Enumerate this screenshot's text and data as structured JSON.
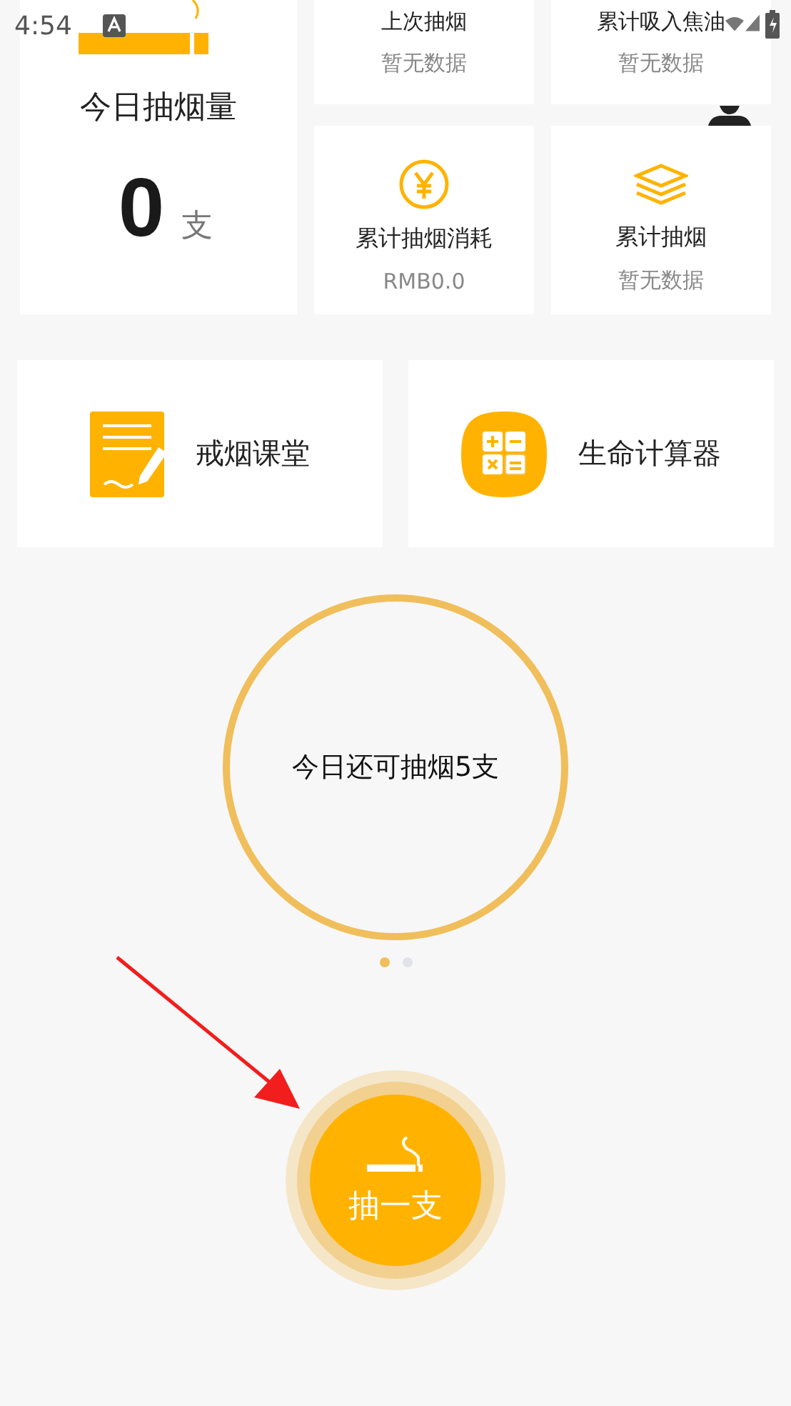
{
  "status_bar": {
    "time": "4:54"
  },
  "today_card": {
    "title": "今日抽烟量",
    "count": "0",
    "unit": "支"
  },
  "stats": [
    {
      "kind": "text",
      "label": "上次抽烟",
      "value": "暂无数据"
    },
    {
      "kind": "text",
      "label": "累计吸入焦油",
      "value": "暂无数据"
    },
    {
      "kind": "money",
      "label": "累计抽烟消耗",
      "value": "RMB0.0"
    },
    {
      "kind": "layers",
      "label": "累计抽烟",
      "value": "暂无数据"
    }
  ],
  "shortcuts": [
    {
      "kind": "course",
      "label": "戒烟课堂"
    },
    {
      "kind": "calculator",
      "label": "生命计算器"
    }
  ],
  "remaining": {
    "text": "今日还可抽烟5支"
  },
  "pager": [
    {
      "selected": true
    },
    {
      "selected": false
    }
  ],
  "smoke_button": {
    "label": "抽一支"
  }
}
